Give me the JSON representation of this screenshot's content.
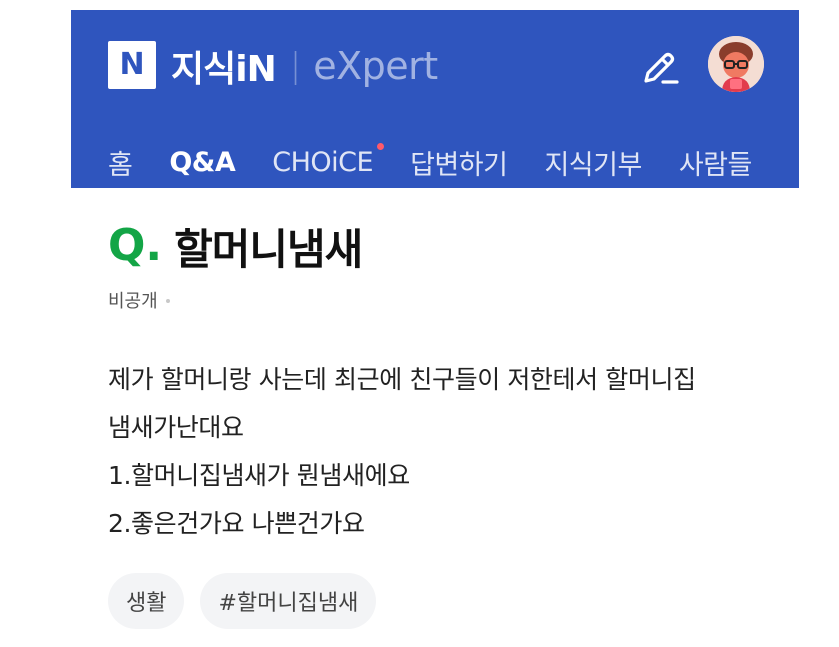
{
  "header": {
    "logo_letter": "N",
    "brand_name": "지식iN",
    "brand_separator": "|",
    "brand_sub": "eXpert",
    "colors": {
      "background": "#2f55be",
      "notification_dot": "#ff5a6b"
    }
  },
  "icons": {
    "write": "pencil-icon",
    "profile": "avatar"
  },
  "nav": {
    "items": [
      {
        "label": "홈",
        "active": false
      },
      {
        "label": "Q&A",
        "active": true
      },
      {
        "label": "CHOiCE",
        "active": false,
        "badge": true
      },
      {
        "label": "답변하기",
        "active": false
      },
      {
        "label": "지식기부",
        "active": false
      },
      {
        "label": "사람들",
        "active": false
      }
    ]
  },
  "question": {
    "marker": "Q",
    "marker_dot": ".",
    "title": "할머니냄새",
    "author": "비공개",
    "body_lines": [
      "제가 할머니랑 사는데 최근에 친구들이 저한테서 할머니집",
      "냄새가난대요",
      "1.할머니집냄새가 뭔냄새에요",
      "2.좋은건가요 나쁜건가요"
    ],
    "accent_color": "#13a546"
  },
  "tags": [
    {
      "label": "생활"
    },
    {
      "label": "#할머니집냄새"
    }
  ]
}
